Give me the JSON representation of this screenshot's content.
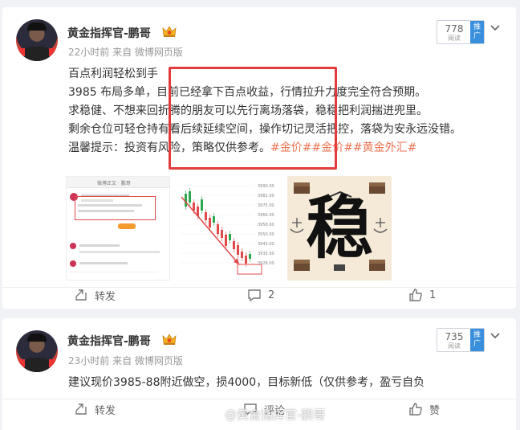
{
  "posts": [
    {
      "author": "黄金指挥官-鹏哥",
      "meta": "22小时前 来自 微博网页版",
      "rank": {
        "num": "778",
        "label": "阅读",
        "push": "推广"
      },
      "lines": [
        "百点利润轻松到手",
        "3985 布局多单，目前已经拿下百点收益，行情拉升力度完全符合预期。",
        "求稳健、不想来回折腾的朋友可以先行离场落袋，稳稳把利润揣进兜里。",
        "剩余仓位可轻仓持有看后续延续空间，操作切记灵活把控，落袋为安永远没错。"
      ],
      "last_line_text": "温馨提示：投资有风险，策略仅供参考。",
      "hashtags": "#金价##金价##黄金外汇#",
      "images": {
        "screenshot_title": "微博正文 · 鹏哥",
        "chart_prices": [
          "3990.00",
          "3982.00",
          "3975.00",
          "3966.00",
          "3958.00",
          "3950.00",
          "3943.00",
          "3935.00",
          "3928.00"
        ],
        "stability_char": "稳"
      },
      "actions": {
        "repost": "转发",
        "comment": "2",
        "like": "1"
      }
    },
    {
      "author": "黄金指挥官-鹏哥",
      "meta": "23小时前 来自 微博网页版",
      "rank": {
        "num": "735",
        "label": "阅读",
        "push": "推广"
      },
      "lines": [
        "建议现价3985-88附近做空，损4000，目标新低（仅供参考，盈亏自负"
      ],
      "actions": {
        "repost": "转发",
        "comment": "评论",
        "like": "赞"
      }
    }
  ],
  "watermark": "@黄金指挥官-鹏哥",
  "colors": {
    "hashtag": "#eb7350",
    "highlight_box": "#e23b3b",
    "push_badge": "#3a8fdd"
  }
}
